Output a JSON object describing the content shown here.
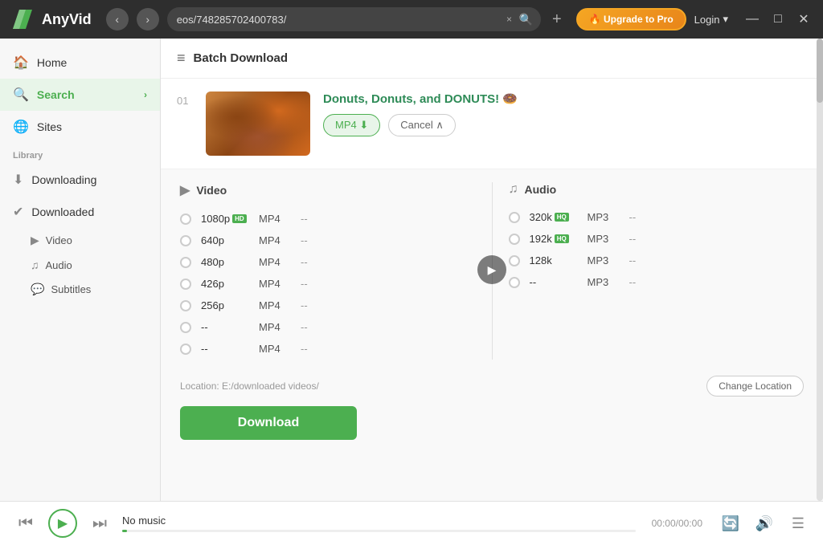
{
  "app": {
    "name": "AnyVid",
    "logo_text": "AnyVid"
  },
  "titlebar": {
    "url": "eos/748285702400783/",
    "upgrade_label": "🔥 Upgrade to Pro",
    "login_label": "Login",
    "close_tab": "×",
    "search_icon": "🔍",
    "add_tab": "+",
    "minimize": "—",
    "maximize": "□",
    "close": "✕"
  },
  "sidebar": {
    "home_label": "Home",
    "search_label": "Search",
    "sites_label": "Sites",
    "library_label": "Library",
    "downloading_label": "Downloading",
    "downloaded_label": "Downloaded",
    "video_label": "Video",
    "audio_label": "Audio",
    "subtitles_label": "Subtitles"
  },
  "batch_download": {
    "title": "Batch Download"
  },
  "video": {
    "number": "01",
    "title": "Donuts, Donuts, and DONUTS! 🍩",
    "mp4_btn": "MP4 ⬇",
    "cancel_btn": "Cancel ∧"
  },
  "options": {
    "video_label": "Video",
    "audio_label": "Audio",
    "rows_video": [
      {
        "res": "1080p",
        "badge": "HD",
        "format": "MP4",
        "size": "--"
      },
      {
        "res": "640p",
        "badge": "",
        "format": "MP4",
        "size": "--"
      },
      {
        "res": "480p",
        "badge": "",
        "format": "MP4",
        "size": "--"
      },
      {
        "res": "426p",
        "badge": "",
        "format": "MP4",
        "size": "--"
      },
      {
        "res": "256p",
        "badge": "",
        "format": "MP4",
        "size": "--"
      },
      {
        "res": "--",
        "badge": "",
        "format": "MP4",
        "size": "--"
      },
      {
        "res": "--",
        "badge": "",
        "format": "MP4",
        "size": "--"
      }
    ],
    "rows_audio": [
      {
        "res": "320k",
        "badge": "HQ",
        "format": "MP3",
        "size": "--"
      },
      {
        "res": "192k",
        "badge": "HQ",
        "format": "MP3",
        "size": "--"
      },
      {
        "res": "128k",
        "badge": "",
        "format": "MP3",
        "size": "--"
      },
      {
        "res": "--",
        "badge": "",
        "format": "MP3",
        "size": "--"
      }
    ]
  },
  "footer": {
    "location_label": "Location: E:/downloaded videos/",
    "change_location": "Change Location",
    "download_label": "Download"
  },
  "player": {
    "no_music": "No music",
    "time": "00:00/00:00"
  }
}
